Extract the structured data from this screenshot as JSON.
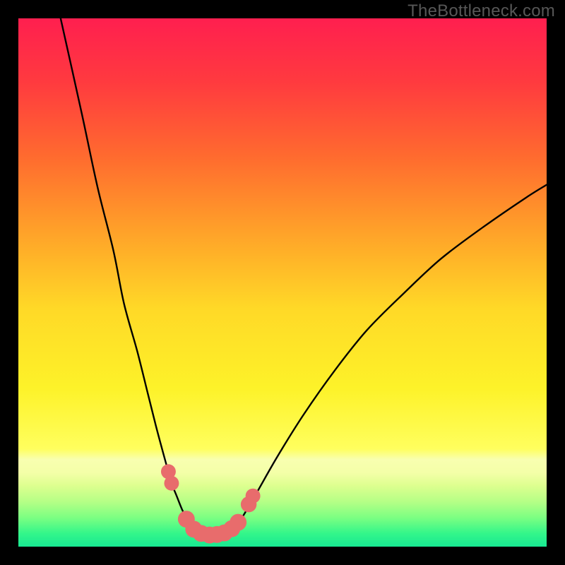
{
  "watermark": "TheBottleneck.com",
  "chart_data": {
    "type": "line",
    "title": "",
    "xlabel": "",
    "ylabel": "",
    "xlim": [
      0,
      100
    ],
    "ylim": [
      0,
      100
    ],
    "grid": false,
    "legend": false,
    "background": {
      "kind": "vertical-gradient",
      "stops": [
        {
          "offset": 0.0,
          "color": "#FF1F4F"
        },
        {
          "offset": 0.12,
          "color": "#FF3A3F"
        },
        {
          "offset": 0.26,
          "color": "#FF6A2F"
        },
        {
          "offset": 0.4,
          "color": "#FFA029"
        },
        {
          "offset": 0.55,
          "color": "#FFD927"
        },
        {
          "offset": 0.7,
          "color": "#FDF229"
        },
        {
          "offset": 0.815,
          "color": "#FFFF5E"
        },
        {
          "offset": 0.835,
          "color": "#F8FFB0"
        },
        {
          "offset": 0.86,
          "color": "#F4FFA8"
        },
        {
          "offset": 0.885,
          "color": "#DDFF8F"
        },
        {
          "offset": 0.915,
          "color": "#B5FF86"
        },
        {
          "offset": 0.945,
          "color": "#7CFF82"
        },
        {
          "offset": 0.975,
          "color": "#33F68A"
        },
        {
          "offset": 1.0,
          "color": "#18E892"
        }
      ]
    },
    "series": [
      {
        "name": "left-curve",
        "x": [
          8.0,
          12.0,
          15.0,
          18.0,
          20.0,
          22.5,
          24.5,
          26.0,
          27.2,
          28.3,
          29.0,
          30.0,
          31.0,
          32.0,
          33.0,
          34.0
        ],
        "y": [
          100.0,
          82.0,
          68.0,
          56.0,
          46.0,
          37.0,
          29.0,
          23.0,
          18.5,
          14.5,
          12.0,
          9.5,
          7.0,
          5.0,
          3.5,
          2.8
        ]
      },
      {
        "name": "right-curve",
        "x": [
          40.0,
          42.0,
          45.0,
          49.0,
          54.0,
          60.0,
          66.0,
          73.0,
          80.0,
          88.0,
          96.0,
          100.0
        ],
        "y": [
          3.0,
          5.0,
          10.0,
          17.0,
          25.0,
          33.5,
          41.0,
          48.0,
          54.5,
          60.5,
          66.0,
          68.5
        ]
      },
      {
        "name": "valley-floor",
        "x": [
          34.0,
          35.0,
          36.0,
          37.0,
          38.0,
          39.0,
          40.0
        ],
        "y": [
          2.8,
          2.4,
          2.2,
          2.2,
          2.3,
          2.6,
          3.0
        ]
      }
    ],
    "markers": [
      {
        "x": 28.4,
        "y": 14.2,
        "r": 1.4,
        "color": "#E86C6C"
      },
      {
        "x": 29.0,
        "y": 12.0,
        "r": 1.4,
        "color": "#E86C6C"
      },
      {
        "x": 31.8,
        "y": 5.2,
        "r": 1.6,
        "color": "#E86C6C"
      },
      {
        "x": 33.2,
        "y": 3.3,
        "r": 1.6,
        "color": "#E86C6C"
      },
      {
        "x": 34.6,
        "y": 2.5,
        "r": 1.6,
        "color": "#E86C6C"
      },
      {
        "x": 36.2,
        "y": 2.2,
        "r": 1.6,
        "color": "#E86C6C"
      },
      {
        "x": 37.6,
        "y": 2.3,
        "r": 1.6,
        "color": "#E86C6C"
      },
      {
        "x": 39.0,
        "y": 2.6,
        "r": 1.6,
        "color": "#E86C6C"
      },
      {
        "x": 40.4,
        "y": 3.4,
        "r": 1.6,
        "color": "#E86C6C"
      },
      {
        "x": 41.6,
        "y": 4.6,
        "r": 1.6,
        "color": "#E86C6C"
      },
      {
        "x": 43.6,
        "y": 8.0,
        "r": 1.5,
        "color": "#E86C6C"
      },
      {
        "x": 44.4,
        "y": 9.6,
        "r": 1.4,
        "color": "#E86C6C"
      }
    ]
  }
}
